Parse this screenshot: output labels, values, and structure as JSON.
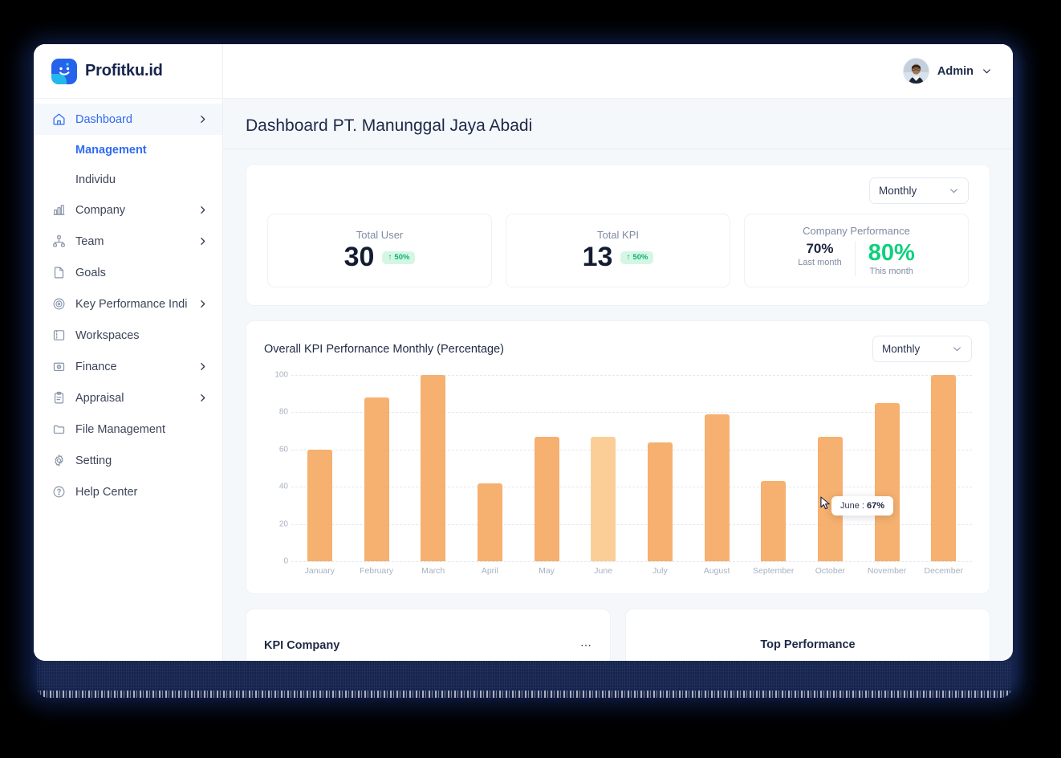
{
  "brand": {
    "name": "Profitku.id"
  },
  "topbar": {
    "user_name": "Admin"
  },
  "page": {
    "title": "Dashboard PT. Manunggal Jaya Abadi"
  },
  "sidebar": {
    "items": [
      {
        "label": "Dashboard",
        "icon": "home-icon",
        "has_chevron": true,
        "active": true
      },
      {
        "label": "Management",
        "sub": true,
        "active": true
      },
      {
        "label": "Individu",
        "sub": true,
        "active": false
      },
      {
        "label": "Company",
        "icon": "building-chart-icon",
        "has_chevron": true,
        "active": false
      },
      {
        "label": "Team",
        "icon": "org-tree-icon",
        "has_chevron": true,
        "active": false
      },
      {
        "label": "Goals",
        "icon": "document-icon",
        "has_chevron": false,
        "active": false
      },
      {
        "label": "Key Performance Indicato",
        "icon": "target-icon",
        "has_chevron": true,
        "active": false
      },
      {
        "label": "Workspaces",
        "icon": "workspace-icon",
        "has_chevron": false,
        "active": false
      },
      {
        "label": "Finance",
        "icon": "money-icon",
        "has_chevron": true,
        "active": false
      },
      {
        "label": "Appraisal",
        "icon": "clipboard-icon",
        "has_chevron": true,
        "active": false
      },
      {
        "label": "File Management",
        "icon": "folder-icon",
        "has_chevron": false,
        "active": false
      },
      {
        "label": "Setting",
        "icon": "gear-icon",
        "has_chevron": false,
        "active": false
      },
      {
        "label": "Help Center",
        "icon": "help-icon",
        "has_chevron": false,
        "active": false
      }
    ]
  },
  "summary": {
    "period_select": {
      "value": "Monthly"
    },
    "stats": [
      {
        "label": "Total User",
        "value": "30",
        "badge": "50%",
        "badge_arrow": "↑"
      },
      {
        "label": "Total KPI",
        "value": "13",
        "badge": "50%",
        "badge_arrow": "↑"
      }
    ],
    "performance": {
      "label": "Company Performance",
      "last_value": "70%",
      "last_caption": "Last month",
      "this_value": "80%",
      "this_caption": "This month"
    }
  },
  "chart_card": {
    "title": "Overall KPI Perfornance Monthly (Percentage)",
    "period_select": {
      "value": "Monthly"
    },
    "tooltip": {
      "label": "June",
      "separator": ":",
      "value": "67%"
    }
  },
  "chart_data": {
    "type": "bar",
    "title": "Overall KPI Perfornance Monthly (Percentage)",
    "xlabel": "",
    "ylabel": "",
    "ylim": [
      0,
      100
    ],
    "yticks": [
      0,
      20,
      40,
      60,
      80,
      100
    ],
    "grid": true,
    "legend": false,
    "bar_color": "#F5A963",
    "highlight_color": "#FCCA8E",
    "highlighted_category": "June",
    "categories": [
      "January",
      "February",
      "March",
      "April",
      "May",
      "June",
      "July",
      "August",
      "September",
      "October",
      "November",
      "December"
    ],
    "values": [
      60,
      88,
      100,
      42,
      67,
      67,
      64,
      79,
      43,
      67,
      85,
      100
    ],
    "annotations": [
      {
        "text": "June : 67%",
        "category": "June",
        "value": 67
      }
    ]
  },
  "bottom_cards": [
    {
      "title": "KPI Company",
      "menu": "⋯"
    },
    {
      "title": "Top Performance",
      "menu": ""
    }
  ]
}
